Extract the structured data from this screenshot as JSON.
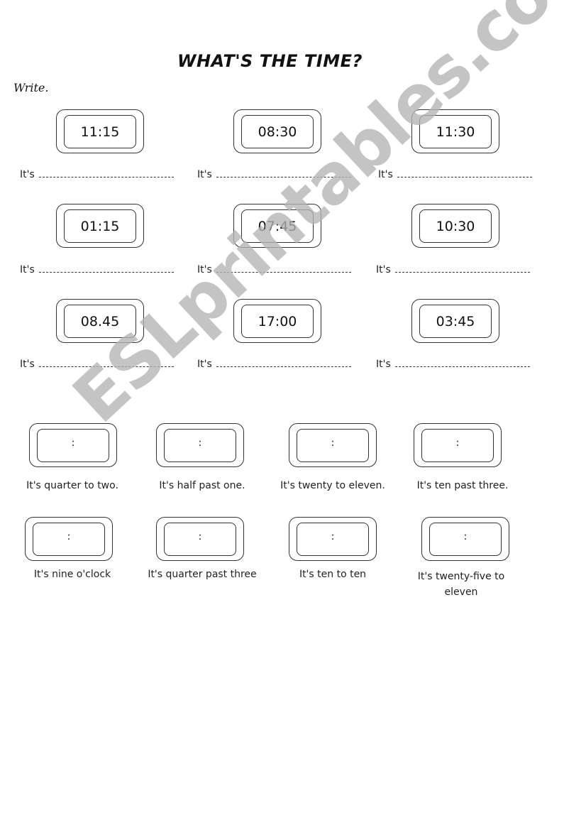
{
  "worksheet": {
    "title": "WHAT'S THE TIME?",
    "instruction": "Write.",
    "section1": {
      "answer_prefix": "It's",
      "clocks": [
        {
          "time": "11:15"
        },
        {
          "time": "08:30"
        },
        {
          "time": "11:30"
        },
        {
          "time": "01:15"
        },
        {
          "time": "07:45"
        },
        {
          "time": "10:30"
        },
        {
          "time": "08.45"
        },
        {
          "time": "17:00"
        },
        {
          "time": "03:45"
        }
      ]
    },
    "section2": {
      "blank_separator": ":",
      "items": [
        {
          "phrase": "It's quarter to two."
        },
        {
          "phrase": "It's half past one."
        },
        {
          "phrase": "It's twenty to eleven."
        },
        {
          "phrase": "It's ten past three."
        },
        {
          "phrase": "It's nine o'clock"
        },
        {
          "phrase": "It's quarter past three"
        },
        {
          "phrase": "It's ten to ten"
        },
        {
          "phrase": "It's twenty-five to eleven"
        }
      ]
    },
    "watermark": "ESLprintables.com"
  }
}
